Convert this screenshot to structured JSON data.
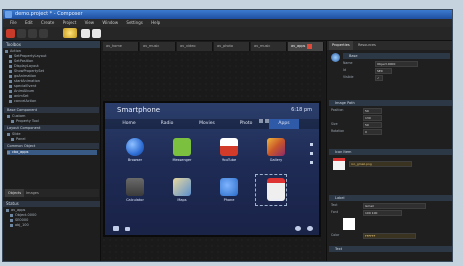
{
  "window": {
    "title": "demo.project * - Composer"
  },
  "menu": [
    "File",
    "Edit",
    "Create",
    "Project",
    "View",
    "Window",
    "Settings",
    "Help"
  ],
  "tabs": [
    {
      "label": "av_home",
      "active": false
    },
    {
      "label": "av_music",
      "active": false
    },
    {
      "label": "av_video",
      "active": false
    },
    {
      "label": "av_photo",
      "active": false
    },
    {
      "label": "av_music",
      "active": false
    },
    {
      "label": "av_apps",
      "active": true
    }
  ],
  "left": {
    "toolbox_header": "Toolbox",
    "tree": [
      {
        "label": "Action",
        "selected": false
      },
      {
        "label": "SetPropertyLayout",
        "selected": false
      },
      {
        "label": "SetPosition",
        "selected": false
      },
      {
        "label": "DisplayLayout",
        "selected": false
      },
      {
        "label": "ShowPropertySet",
        "selected": false
      },
      {
        "label": "goAnimation",
        "selected": false
      },
      {
        "label": "startAnimation",
        "selected": false
      },
      {
        "label": "specialEvent",
        "selected": false
      },
      {
        "label": "AnimAlbum",
        "selected": false
      },
      {
        "label": "animSet",
        "selected": false
      },
      {
        "label": "cancelAction",
        "selected": false
      }
    ],
    "sections": [
      "Base Component",
      "Custom",
      "Property Tool",
      "Layout Component",
      "Slide",
      "Panel",
      "Common Object",
      "cbo_apps"
    ],
    "objects_tabs": [
      "Objects",
      "Images"
    ],
    "status_header": "Status",
    "object_tree": [
      "av_apps",
      "Object.0000",
      "SE0000",
      "obj_100"
    ]
  },
  "phone": {
    "title": "Smartphone",
    "time": "6:18 pm",
    "tabs": [
      {
        "label": "Home",
        "active": false
      },
      {
        "label": "Radio",
        "active": false
      },
      {
        "label": "Movies",
        "active": false
      },
      {
        "label": "Photo",
        "active": false
      },
      {
        "label": "Apps",
        "active": true
      }
    ],
    "apps": [
      {
        "label": "Browser",
        "color": "#2f6fd6"
      },
      {
        "label": "Messenger",
        "color": "#7cc040"
      },
      {
        "label": "YouTube",
        "color": "#d23a2a"
      },
      {
        "label": "Gallery",
        "color": "#c8562a"
      },
      {
        "label": "Calculator",
        "color": "#5a5a5a"
      },
      {
        "label": "Maps",
        "color": "#5b8fd0"
      },
      {
        "label": "Phone",
        "color": "#2a6cc8"
      },
      {
        "label": "Gmail",
        "color": "#e6e6e6"
      }
    ]
  },
  "right": {
    "tabs": [
      "Properties",
      "Resources"
    ],
    "sections": [
      "Base",
      "Image Path",
      "Icon Item",
      "Label",
      "Text"
    ],
    "rows": [
      {
        "k": "Name",
        "v": "Object.0000"
      },
      {
        "k": "Id",
        "v": "SE0"
      },
      {
        "k": "Visible",
        "v": "✓"
      },
      {
        "k": "Position",
        "v": "50"
      },
      {
        "k": "",
        "v": "130"
      },
      {
        "k": "Size",
        "v": "50"
      },
      {
        "k": "Rotation",
        "v": "0"
      },
      {
        "k": "Image",
        "v": "ico_gmail.png"
      },
      {
        "k": "Text",
        "v": "Gmail"
      },
      {
        "k": "Font",
        "v": "100 100"
      },
      {
        "k": "Color",
        "v": "FFFFFF"
      }
    ]
  }
}
